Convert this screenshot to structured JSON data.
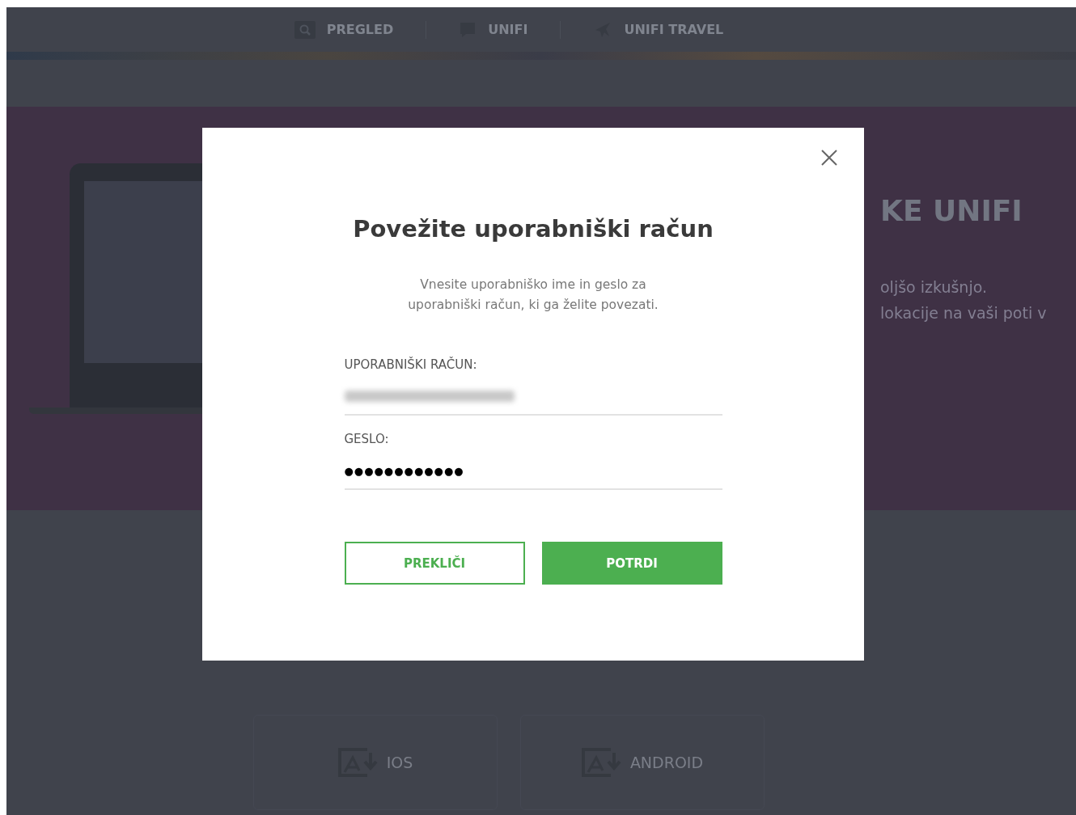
{
  "nav": {
    "items": [
      {
        "label": "PREGLED"
      },
      {
        "label": "UNIFI"
      },
      {
        "label": "UNIFI TRAVEL"
      }
    ]
  },
  "hero": {
    "title": "KE UNIFI",
    "lines": [
      "oljšo izkušnjo.",
      "lokacije na vaši poti v"
    ]
  },
  "downloads": [
    {
      "label": "IOS"
    },
    {
      "label": "ANDROID"
    }
  ],
  "dialog": {
    "title": "Povežite uporabniški račun",
    "description": "Vnesite uporabniško ime in geslo za uporabniški račun, ki ga želite povezati.",
    "fields": [
      {
        "label": "UPORABNIŠKI RAČUN:",
        "kind": "redacted"
      },
      {
        "label": "GESLO:",
        "kind": "password",
        "value": "●●●●●●●●●●●●"
      }
    ],
    "buttons": [
      {
        "label": "PREKLIČI",
        "kind": "secondary"
      },
      {
        "label": "POTRDI",
        "kind": "primary"
      }
    ]
  }
}
